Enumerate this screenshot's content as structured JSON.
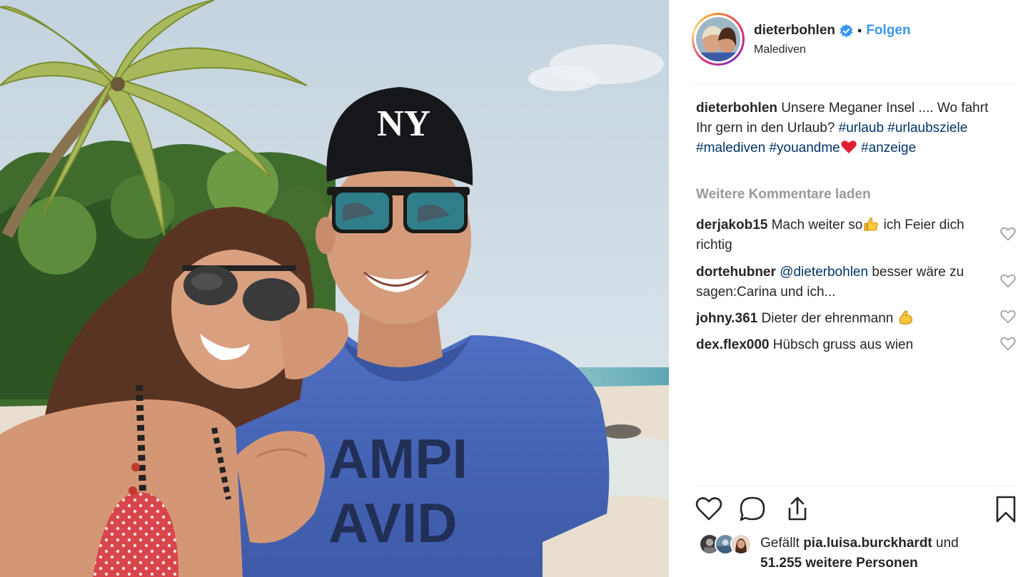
{
  "post": {
    "username": "dieterbohlen",
    "dot": "•",
    "follow_label": "Folgen",
    "location": "Malediven"
  },
  "caption": {
    "username": "dieterbohlen",
    "text": "Unsere Meganer Insel .... Wo fahrt Ihr gern in den Urlaub?",
    "tags": [
      "#urlaub",
      "#urlaubsziele",
      "#malediven",
      "#youandme",
      "#anzeige"
    ]
  },
  "load_more_label": "Weitere Kommentare laden",
  "comments": [
    {
      "username": "derjakob15",
      "text_before": "Mach weiter so",
      "text_after": " ich Feier dich richtig"
    },
    {
      "username": "dortehubner",
      "mention": "@dieterbohlen",
      "text": " besser wäre zu sagen:Carina und ich..."
    },
    {
      "username": "johny.361",
      "text": "Dieter der ehrenmann "
    },
    {
      "username": "dex.flex000",
      "text": "Hübsch gruss aus wien"
    }
  ],
  "likes": {
    "prefix": "Gefällt ",
    "user": "pia.luisa.burckhardt",
    "middle": " und",
    "count_text": "51.255 weitere Personen"
  },
  "icons": {
    "verified": "verified-badge-icon",
    "like": "heart-outline-icon",
    "comment": "comment-bubble-icon",
    "share": "share-upload-icon",
    "save": "bookmark-outline-icon"
  },
  "colors": {
    "accent": "#3897f0",
    "hashtag": "#003569",
    "muted": "#999999",
    "text": "#262626"
  }
}
